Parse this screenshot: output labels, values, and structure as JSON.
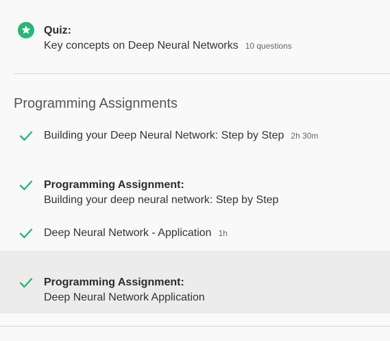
{
  "quiz": {
    "heading": "Quiz:",
    "title": "Key concepts on Deep Neural Networks",
    "meta": "10 questions",
    "icon": "star-badge-icon",
    "accent": "#2bb673"
  },
  "section": {
    "title": "Programming Assignments"
  },
  "items": [
    {
      "title": "Building your Deep Neural Network: Step by Step",
      "meta": "2h 30m",
      "icon": "checkmark-icon"
    },
    {
      "heading": "Programming Assignment:",
      "title": "Building your deep neural network: Step by Step",
      "icon": "checkmark-icon"
    },
    {
      "title": "Deep Neural Network - Application",
      "meta": "1h",
      "icon": "checkmark-icon"
    },
    {
      "heading": "Programming Assignment:",
      "title": "Deep Neural Network Application",
      "icon": "checkmark-icon"
    }
  ],
  "colors": {
    "check": "#2bb673",
    "highlight_bg": "#ececec"
  }
}
